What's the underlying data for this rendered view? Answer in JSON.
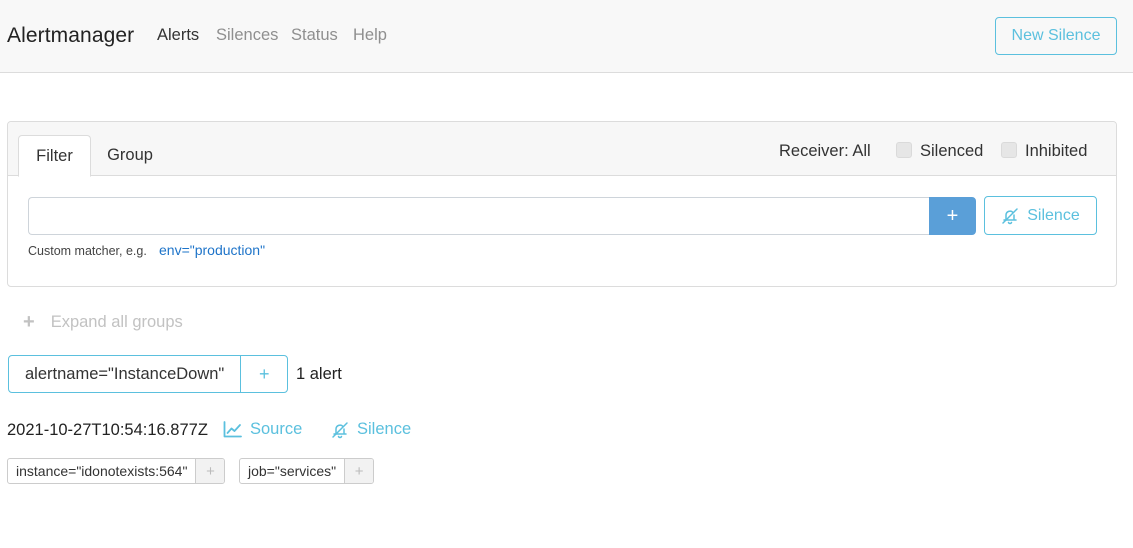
{
  "navbar": {
    "brand": "Alertmanager",
    "items": [
      {
        "label": "Alerts"
      },
      {
        "label": "Silences"
      },
      {
        "label": "Status"
      },
      {
        "label": "Help"
      }
    ],
    "new_silence_label": "New Silence"
  },
  "filter_card": {
    "tabs": [
      {
        "label": "Filter"
      },
      {
        "label": "Group"
      }
    ],
    "receiver_label": "Receiver: All",
    "silenced_label": "Silenced",
    "inhibited_label": "Inhibited",
    "input_value": "",
    "input_placeholder": "",
    "add_button_label": "+",
    "silence_button_label": "Silence",
    "hint_text": "Custom matcher, e.g.",
    "hint_example": "env=\"production\""
  },
  "expand_all_label": "Expand all groups",
  "group": {
    "label": "alertname=\"InstanceDown\"",
    "plus_label": "+",
    "count_label": "1 alert"
  },
  "alert": {
    "timestamp": "2021-10-27T10:54:16.877Z",
    "source_label": "Source",
    "silence_label": "Silence",
    "labels": [
      {
        "text": "instance=\"idonotexists:564\"",
        "plus": "+"
      },
      {
        "text": "job=\"services\"",
        "plus": "+"
      }
    ]
  },
  "colors": {
    "accent": "#5bc0de",
    "primary": "#5a9fd8",
    "link": "#1e74c9",
    "navbar_bg": "#f8f8f8"
  },
  "icons": {
    "source": "chart-line-icon",
    "silence": "bell-slash-icon",
    "expand": "plus-icon"
  }
}
